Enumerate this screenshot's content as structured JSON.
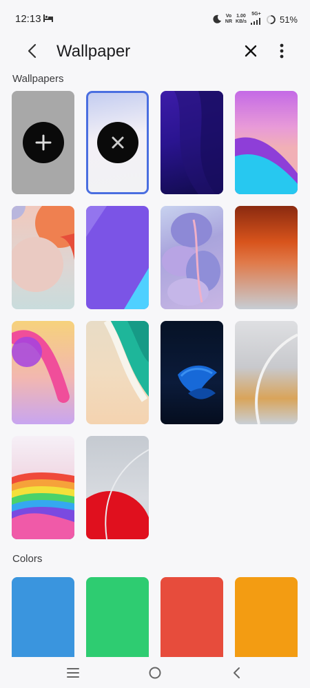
{
  "status": {
    "time": "12:13",
    "vo": "Vo",
    "nr": "NR",
    "speed": "1.00",
    "speed_unit": "KB/s",
    "net": "5G+",
    "battery": "51%"
  },
  "header": {
    "title": "Wallpaper"
  },
  "sections": {
    "wallpapers_label": "Wallpapers",
    "colors_label": "Colors"
  },
  "colors": [
    "#3a95de",
    "#2ecc71",
    "#e74c3c",
    "#f39c12"
  ],
  "accent": "#4a6ee0"
}
